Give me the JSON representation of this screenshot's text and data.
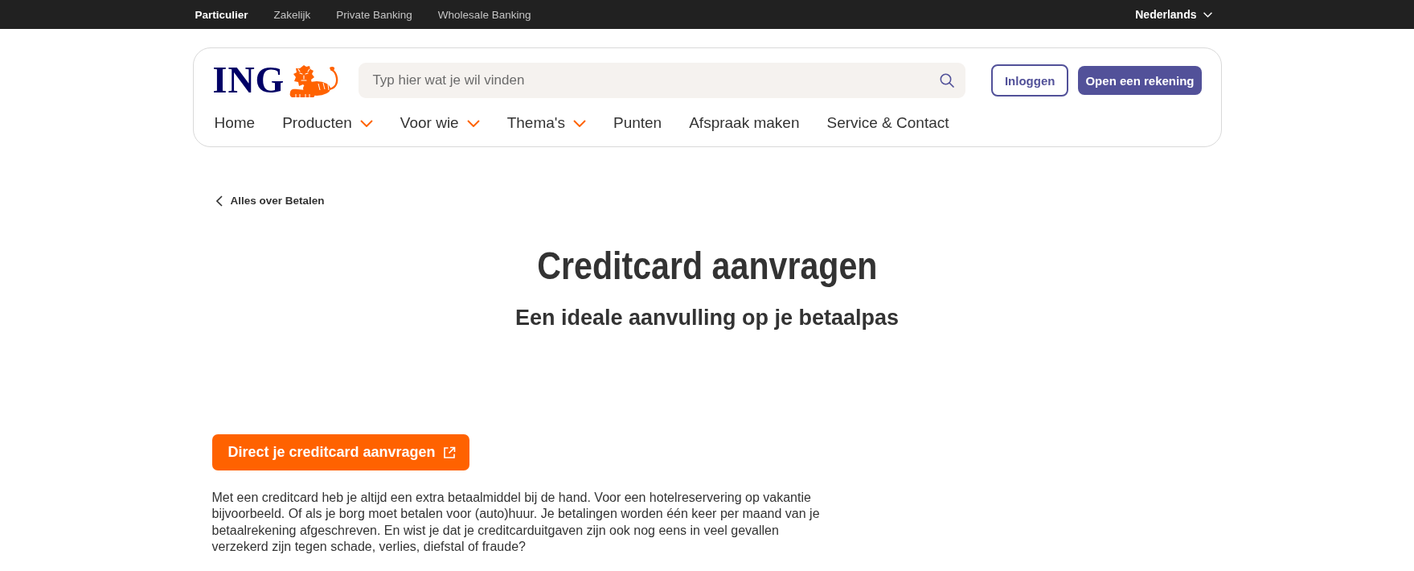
{
  "top_bar": {
    "segments": [
      {
        "label": "Particulier",
        "selected": true
      },
      {
        "label": "Zakelijk",
        "selected": false
      },
      {
        "label": "Private Banking",
        "selected": false
      },
      {
        "label": "Wholesale Banking",
        "selected": false
      }
    ],
    "language": "Nederlands"
  },
  "header": {
    "logo": "ING",
    "search": {
      "placeholder": "Typ hier wat je wil vinden"
    },
    "buttons": [
      {
        "label": "Inloggen",
        "kind": "outline"
      },
      {
        "label": "Open een rekening",
        "kind": "filled"
      }
    ],
    "nav": [
      {
        "label": "Home",
        "has_menu": false
      },
      {
        "label": "Producten",
        "has_menu": true
      },
      {
        "label": "Voor wie",
        "has_menu": true
      },
      {
        "label": "Thema's",
        "has_menu": true
      },
      {
        "label": "Punten",
        "has_menu": false
      },
      {
        "label": "Afspraak maken",
        "has_menu": false
      },
      {
        "label": "Service & Contact",
        "has_menu": false
      }
    ]
  },
  "back_link": "Alles over Betalen",
  "title": "Creditcard aanvragen",
  "subtitle": "Een ideale aanvulling op je betaalpas",
  "cta": {
    "label": "Direct je creditcard aanvragen"
  },
  "intro": "Met een creditcard heb je altijd een extra betaalmiddel bij de hand. Voor een hotelreservering op vakantie bijvoorbeeld. Of als je borg moet betalen voor (auto)huur. Je betalingen worden één keer per maand van je betaalrekening afgeschreven. En wist je dat je creditcarduitgaven zijn ook nog eens in veel gevallen verzekerd zijn tegen schade, verlies, diefstal of fraude?"
}
